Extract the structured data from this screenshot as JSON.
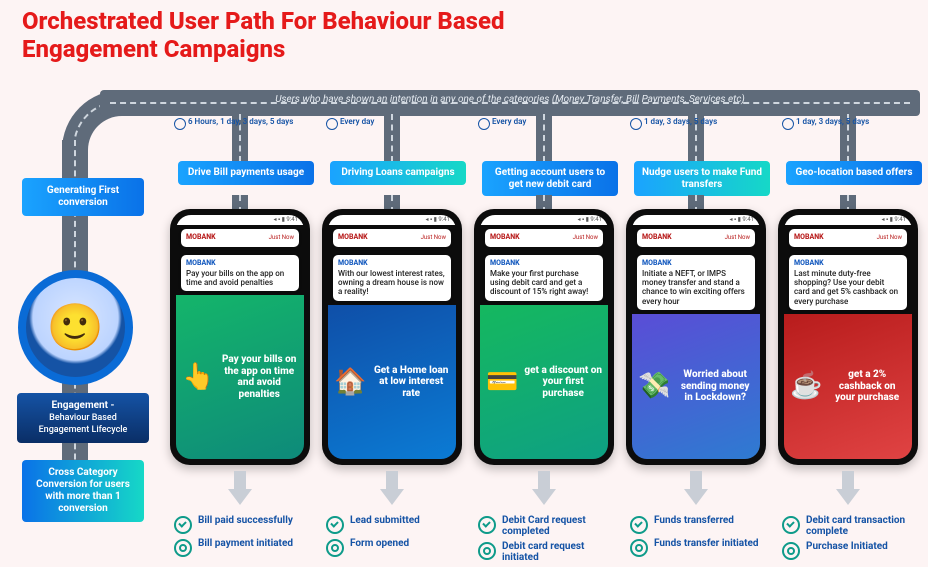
{
  "title": "Orchestrated User Path For Behaviour Based Engagement Campaigns",
  "road_text": "Users who have shown an intention in any one of the categories (Money Transfer, Bill Payments, Services etc)",
  "left": {
    "top_pill": "Generating First conversion",
    "engagement_label": "Engagement -",
    "engagement_sub": "Behaviour Based Engagement Lifecycle",
    "bottom_pill": "Cross Category Conversion for users with more than 1 conversion"
  },
  "brand": "MOBANK",
  "notif_when": "Just Now",
  "statusbar": "◂ ▪ ▮ 9:41",
  "columns": [
    {
      "timing": "6 Hours, 1 day, 3 days, 5 days",
      "label": "Drive Bill payments usage",
      "notif_msg": "Pay your bills on the app on time and avoid penalties",
      "hero_msg": "Pay your bills on the app on time and avoid penalties",
      "hero_icon": "👆",
      "outcomes": [
        {
          "icon": "chk",
          "text": "Bill paid successfully"
        },
        {
          "icon": "tgt",
          "text": "Bill payment initiated"
        }
      ]
    },
    {
      "timing": "Every day",
      "label": "Driving Loans campaigns",
      "notif_msg": "With our lowest interest rates, owning a dream house is now a reality!",
      "hero_msg": "Get a Home loan at low interest rate",
      "hero_icon": "🏠",
      "outcomes": [
        {
          "icon": "chk",
          "text": "Lead submitted"
        },
        {
          "icon": "tgt",
          "text": "Form opened"
        }
      ]
    },
    {
      "timing": "Every day",
      "label": "Getting account users to get new debit card",
      "notif_msg": "Make your first purchase using debit card and get a discount of 15% right away!",
      "hero_msg": "get a discount on your first purchase",
      "hero_icon": "💳",
      "outcomes": [
        {
          "icon": "chk",
          "text": "Debit Card request completed"
        },
        {
          "icon": "tgt",
          "text": "Debit card request initiated"
        }
      ]
    },
    {
      "timing": "1 day, 3 days, 5 days",
      "label": "Nudge users to make Fund transfers",
      "notif_msg": "Initiate a NEFT, or IMPS money transfer and stand a chance to win exciting offers every hour",
      "hero_msg": "Worried about sending money in Lockdown?",
      "hero_icon": "💸",
      "outcomes": [
        {
          "icon": "chk",
          "text": "Funds transferred"
        },
        {
          "icon": "tgt",
          "text": "Funds transfer initiated"
        }
      ]
    },
    {
      "timing": "1 day, 3 days, 5 days",
      "label": "Geo-location based offers",
      "notif_msg": "Last minute duty-free shopping? Use your debit card and get 5% cashback on every purchase",
      "hero_msg": "get a 2% cashback on your purchase",
      "hero_icon": "☕",
      "outcomes": [
        {
          "icon": "chk",
          "text": "Debit card transaction complete"
        },
        {
          "icon": "tgt",
          "text": "Purchase Initiated"
        }
      ]
    }
  ]
}
